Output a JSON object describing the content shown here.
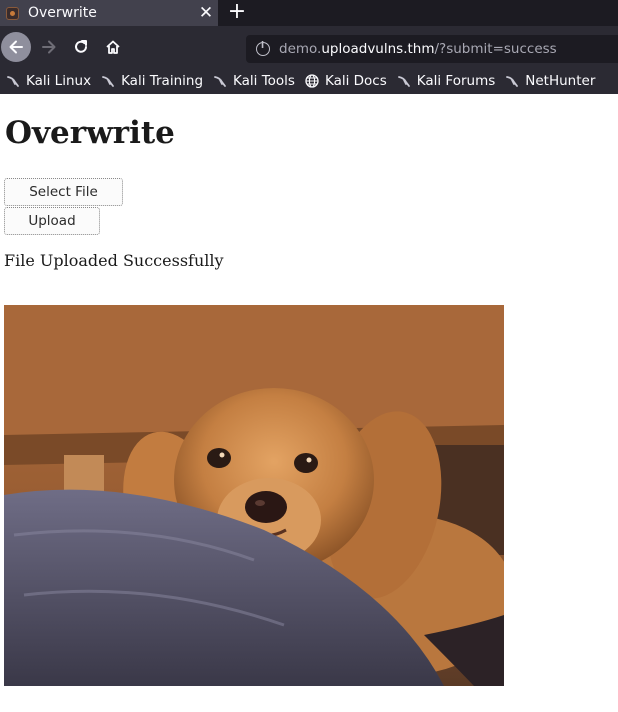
{
  "browser": {
    "tab": {
      "title": "Overwrite",
      "close_glyph": "✕",
      "favicon": "page-favicon"
    },
    "new_tab_glyph": "+",
    "nav": {
      "back_icon": "back-arrow-icon",
      "forward_icon": "forward-arrow-icon",
      "reload_icon": "reload-icon",
      "home_icon": "home-icon"
    },
    "url": {
      "prefix": "demo.",
      "host": "uploadvulns.thm",
      "path": "/?submit=success"
    },
    "bookmarks": [
      {
        "label": "Kali Linux",
        "icon": "kali-dragon-icon"
      },
      {
        "label": "Kali Training",
        "icon": "kali-dragon-icon"
      },
      {
        "label": "Kali Tools",
        "icon": "kali-dragon-icon"
      },
      {
        "label": "Kali Docs",
        "icon": "globe-icon"
      },
      {
        "label": "Kali Forums",
        "icon": "kali-dragon-icon"
      },
      {
        "label": "NetHunter",
        "icon": "kali-dragon-icon"
      }
    ]
  },
  "page": {
    "title": "Overwrite",
    "select_file_label": "Select File",
    "upload_label": "Upload",
    "status_message": "File Uploaded Successfully",
    "image": "photo of a cocker spaniel dog resting its head on a grey cushion"
  },
  "colors": {
    "tabbar_bg": "#1c1b22",
    "toolbar_bg": "#2b2a33",
    "active_tab_bg": "#42414d",
    "urlbar_bg": "#1c1b22",
    "text_light": "#fbfbfe"
  }
}
